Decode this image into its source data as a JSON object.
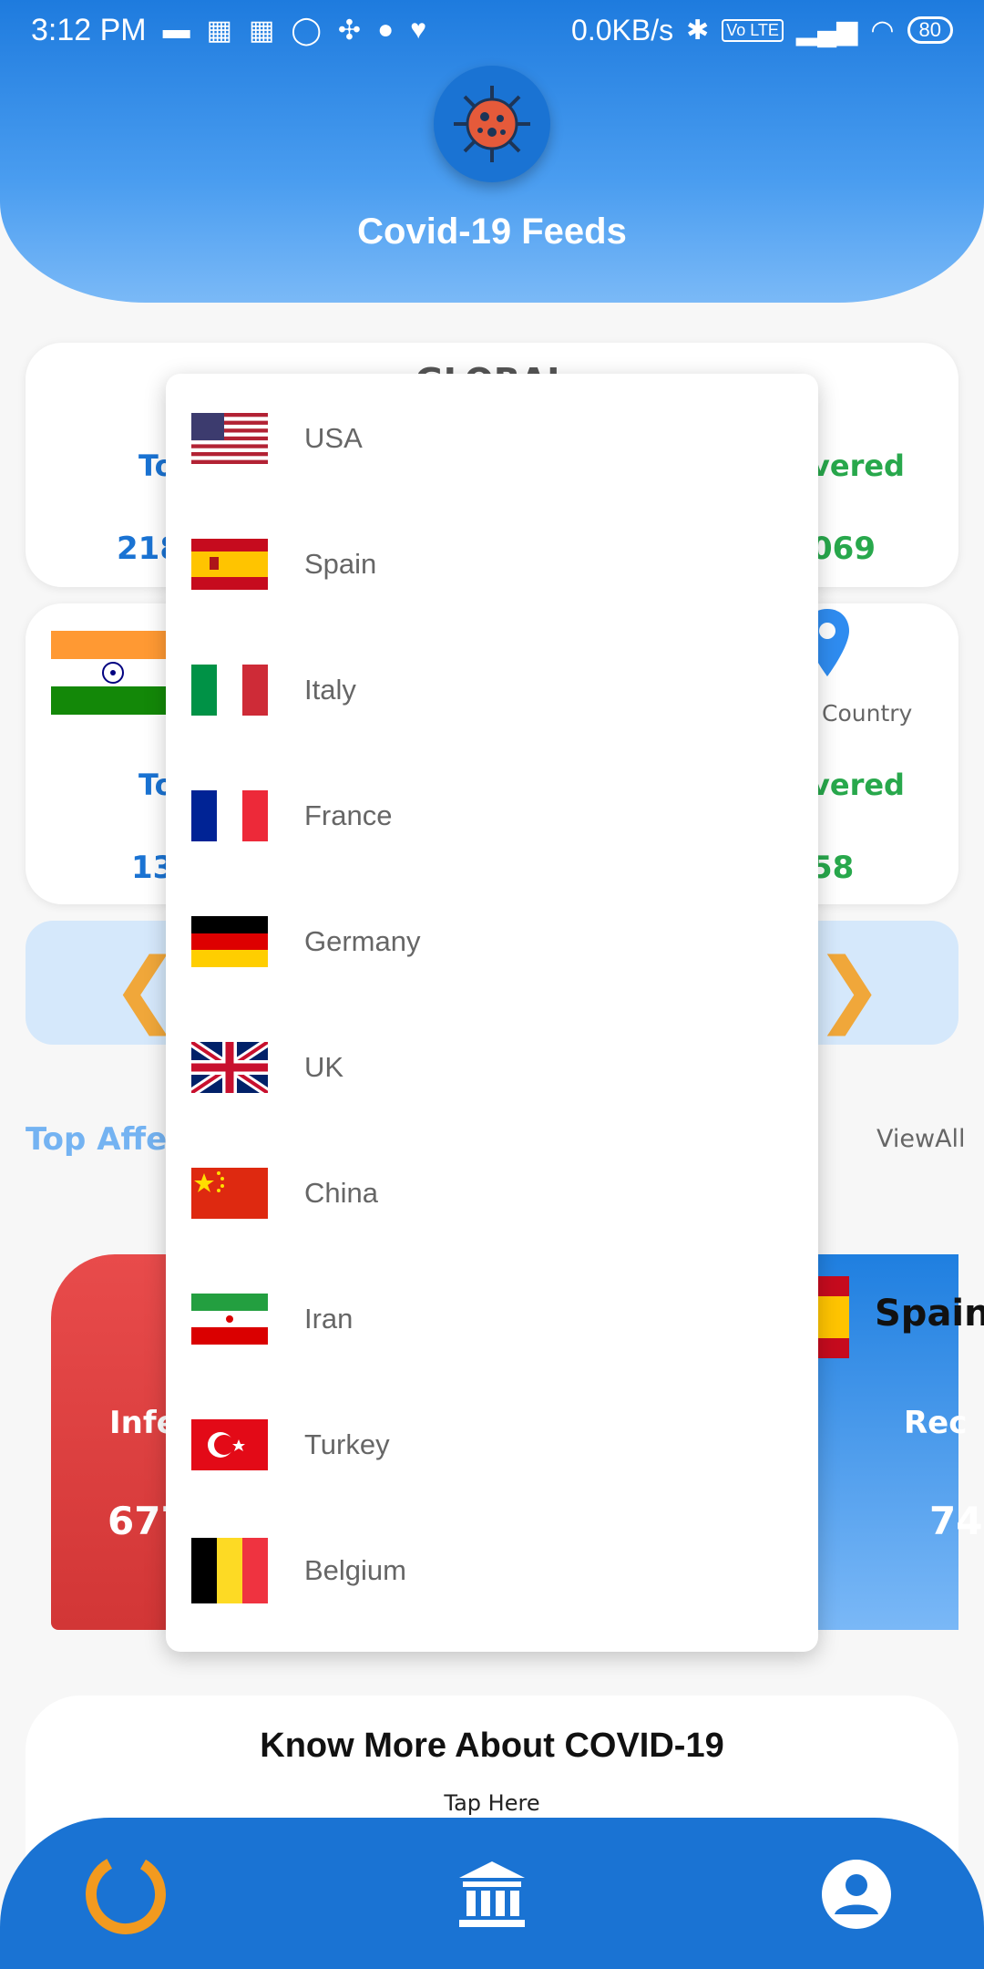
{
  "status_bar": {
    "time": "3:12 PM",
    "speed": "0.0KB/s",
    "battery": "80",
    "volte": "Vo LTE"
  },
  "header": {
    "title": "Covid-19 Feeds",
    "logo_icon": "virus-icon"
  },
  "global_card": {
    "title": "GLOBAL",
    "total_label_fragment": "To",
    "total_value_fragment": "218",
    "recovered_label_fragment": "vered",
    "recovered_value_fragment": "069"
  },
  "country_card": {
    "total_label_fragment": "To",
    "total_value_fragment": "134",
    "recovered_label_fragment": "vered",
    "recovered_value_fragment": "58",
    "select_label": "Country",
    "flag": "india-flag"
  },
  "top_affected": {
    "title_fragment": "Top Affec",
    "view_all": "ViewAll",
    "infected_label_fragment": "Infe",
    "infected_value_fragment": "677",
    "spain_name_fragment": "Spain",
    "recovered_label_fragment": "Rec",
    "recovered_value_fragment": "74"
  },
  "know_more": {
    "title": "Know More About COVID-19",
    "subtitle": "Tap Here"
  },
  "dropdown": {
    "items": [
      {
        "label": "USA",
        "flag": "usa-flag"
      },
      {
        "label": "Spain",
        "flag": "spain-flag"
      },
      {
        "label": "Italy",
        "flag": "italy-flag"
      },
      {
        "label": "France",
        "flag": "france-flag"
      },
      {
        "label": "Germany",
        "flag": "germany-flag"
      },
      {
        "label": "UK",
        "flag": "uk-flag"
      },
      {
        "label": "China",
        "flag": "china-flag"
      },
      {
        "label": "Iran",
        "flag": "iran-flag"
      },
      {
        "label": "Turkey",
        "flag": "turkey-flag"
      },
      {
        "label": "Belgium",
        "flag": "belgium-flag"
      }
    ]
  },
  "bottom_nav": {
    "items": [
      "stats-ring-icon",
      "bank-icon",
      "profile-icon"
    ]
  },
  "colors": {
    "primary": "#1a73d3",
    "recovered": "#28a84c",
    "infected": "#d23636",
    "accent_chevron": "#f0a73a"
  }
}
